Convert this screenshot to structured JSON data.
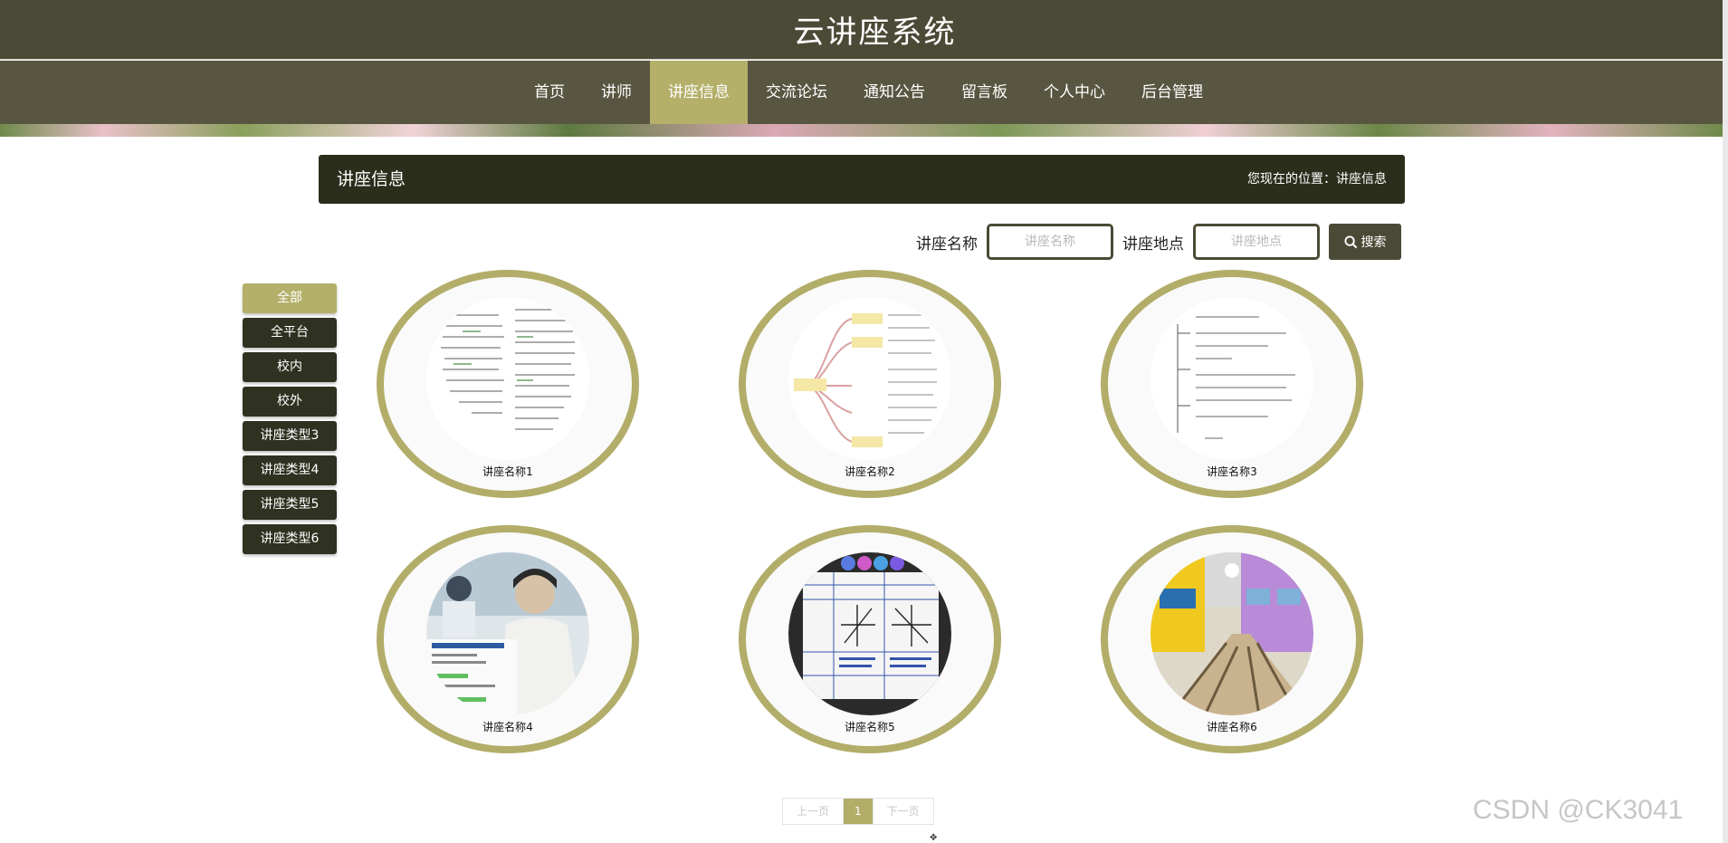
{
  "header": {
    "title": "云讲座系统"
  },
  "nav": {
    "items": [
      {
        "label": "首页",
        "active": false
      },
      {
        "label": "讲师",
        "active": false
      },
      {
        "label": "讲座信息",
        "active": true
      },
      {
        "label": "交流论坛",
        "active": false
      },
      {
        "label": "通知公告",
        "active": false
      },
      {
        "label": "留言板",
        "active": false
      },
      {
        "label": "个人中心",
        "active": false
      },
      {
        "label": "后台管理",
        "active": false
      }
    ]
  },
  "page": {
    "title": "讲座信息",
    "location": "您现在的位置：讲座信息"
  },
  "search": {
    "name_label": "讲座名称",
    "name_placeholder": "讲座名称",
    "place_label": "讲座地点",
    "place_placeholder": "讲座地点",
    "button_label": "搜索"
  },
  "sidebar": {
    "items": [
      {
        "label": "全部",
        "active": true
      },
      {
        "label": "全平台",
        "active": false
      },
      {
        "label": "校内",
        "active": false
      },
      {
        "label": "校外",
        "active": false
      },
      {
        "label": "讲座类型3",
        "active": false
      },
      {
        "label": "讲座类型4",
        "active": false
      },
      {
        "label": "讲座类型5",
        "active": false
      },
      {
        "label": "讲座类型6",
        "active": false
      }
    ]
  },
  "lectures": [
    {
      "name": "讲座名称1",
      "image": "mindmap-notes"
    },
    {
      "name": "讲座名称2",
      "image": "mindmap-tree"
    },
    {
      "name": "讲座名称3",
      "image": "outline-notes"
    },
    {
      "name": "讲座名称4",
      "image": "classroom-portrait"
    },
    {
      "name": "讲座名称5",
      "image": "math-table"
    },
    {
      "name": "讲座名称6",
      "image": "computer-lab"
    }
  ],
  "pagination": {
    "prev": "上一页",
    "current": "1",
    "next": "下一页"
  },
  "watermark": "CSDN @CK3041",
  "colors": {
    "header_bg": "#4b4a36",
    "nav_bg": "#585641",
    "accent": "#b4b06a",
    "dark": "#2c2e1c"
  }
}
